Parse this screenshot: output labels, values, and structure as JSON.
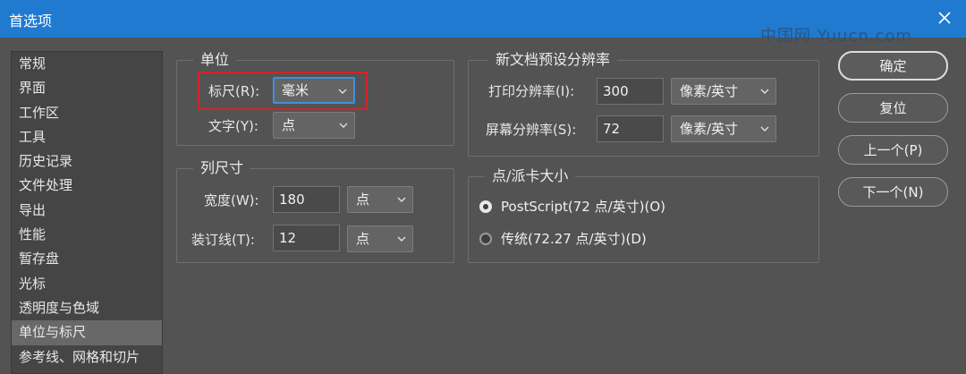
{
  "window": {
    "title": "首选项",
    "watermark": "中国网 Yuucn.com"
  },
  "sidebar": {
    "items": [
      {
        "label": "常规"
      },
      {
        "label": "界面"
      },
      {
        "label": "工作区"
      },
      {
        "label": "工具"
      },
      {
        "label": "历史记录"
      },
      {
        "label": "文件处理"
      },
      {
        "label": "导出"
      },
      {
        "label": "性能"
      },
      {
        "label": "暂存盘"
      },
      {
        "label": "光标"
      },
      {
        "label": "透明度与色域"
      },
      {
        "label": "单位与标尺"
      },
      {
        "label": "参考线、网格和切片"
      }
    ],
    "selected_label": "单位与标尺"
  },
  "units": {
    "title": "单位",
    "ruler_label": "标尺(R):",
    "ruler_value": "毫米",
    "type_label": "文字(Y):",
    "type_value": "点"
  },
  "column_size": {
    "title": "列尺寸",
    "width_label": "宽度(W):",
    "width_value": "180",
    "width_unit": "点",
    "gutter_label": "装订线(T):",
    "gutter_value": "12",
    "gutter_unit": "点"
  },
  "new_doc_resolution": {
    "title": "新文档预设分辨率",
    "print_label": "打印分辨率(I):",
    "print_value": "300",
    "print_unit": "像素/英寸",
    "screen_label": "屏幕分辨率(S):",
    "screen_value": "72",
    "screen_unit": "像素/英寸"
  },
  "point_pica": {
    "title": "点/派卡大小",
    "options": [
      {
        "label": "PostScript(72 点/英寸)(O)",
        "checked": true
      },
      {
        "label": "传统(72.27 点/英寸)(D)",
        "checked": false
      }
    ]
  },
  "buttons": {
    "ok": "确定",
    "reset": "复位",
    "prev": "上一个(P)",
    "next": "下一个(N)"
  }
}
